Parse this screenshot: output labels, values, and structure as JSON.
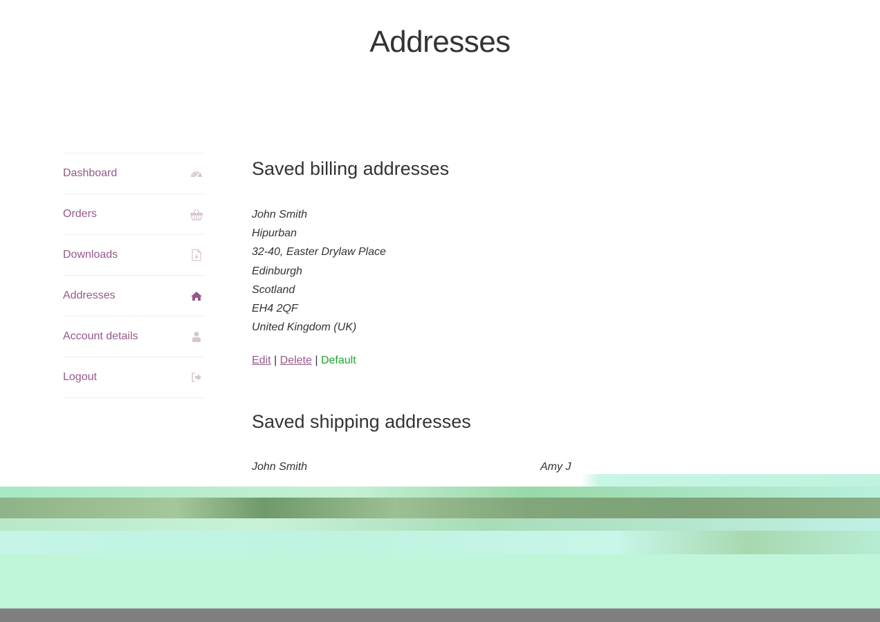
{
  "page": {
    "title": "Addresses"
  },
  "nav": {
    "items": [
      {
        "label": "Dashboard",
        "icon": "dashboard-icon"
      },
      {
        "label": "Orders",
        "icon": "basket-icon"
      },
      {
        "label": "Downloads",
        "icon": "file-download-icon"
      },
      {
        "label": "Addresses",
        "icon": "home-icon",
        "active": true
      },
      {
        "label": "Account details",
        "icon": "user-icon"
      },
      {
        "label": "Logout",
        "icon": "logout-icon"
      }
    ],
    "link_color": "#96588a",
    "icon_color": "#d8c6d4",
    "active_icon_color": "#96588a"
  },
  "billing": {
    "heading": "Saved billing addresses",
    "address": [
      "John Smith",
      "Hipurban",
      "32-40, Easter Drylaw Place",
      "Edinburgh",
      "Scotland",
      "EH4 2QF",
      "United Kingdom (UK)"
    ],
    "actions": {
      "edit": "Edit",
      "separator": "|",
      "delete": "Delete",
      "default": "Default"
    }
  },
  "shipping": {
    "heading": "Saved shipping addresses",
    "addresses": [
      {
        "name": "John Smith"
      },
      {
        "name": "Amy J"
      }
    ]
  },
  "colors": {
    "accent": "#96588a",
    "default_green": "#1fa32e",
    "text": "#333333"
  }
}
